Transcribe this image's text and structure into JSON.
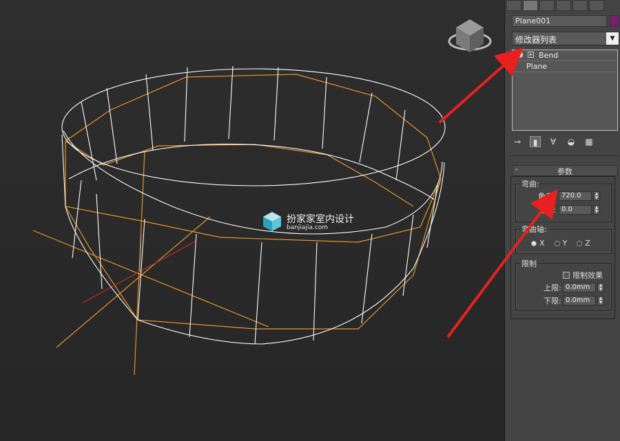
{
  "object_name": "Plane001",
  "object_color": "#7a1e6e",
  "modifier_list_label": "修改器列表",
  "stack": [
    {
      "label": "Bend"
    },
    {
      "label": "Plane"
    }
  ],
  "params": {
    "rollout_title": "参数",
    "bend_group": "弯曲:",
    "angle_label": "角度:",
    "angle_value": "720.0",
    "direction_label": "方向:",
    "direction_value": "0.0",
    "axis_group": "弯曲轴:",
    "axis_x": "X",
    "axis_y": "Y",
    "axis_z": "Z",
    "limit_group": "限制",
    "limit_effect_label": "限制效果",
    "upper_label": "上限:",
    "upper_value": "0.0mm",
    "lower_label": "下限:",
    "lower_value": "0.0mm"
  },
  "watermark": {
    "title": "扮家家室内设计",
    "subtitle": "banjiajia.com"
  },
  "colors": {
    "wire": "#ffffff",
    "gizmo": "#e8952a",
    "axis": "#c02a2a",
    "annotation": "#e82020"
  }
}
